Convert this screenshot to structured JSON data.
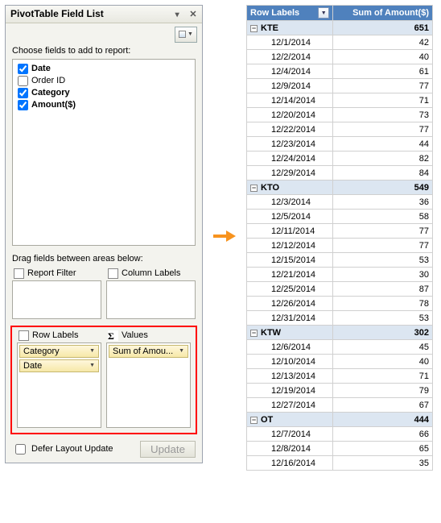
{
  "panel": {
    "title": "PivotTable Field List",
    "choose_label": "Choose fields to add to report:",
    "fields": [
      {
        "label": "Date",
        "checked": true
      },
      {
        "label": "Order ID",
        "checked": false
      },
      {
        "label": "Category",
        "checked": true
      },
      {
        "label": "Amount($)",
        "checked": true
      }
    ],
    "drag_label": "Drag fields between areas below:",
    "areas": {
      "report_filter": "Report Filter",
      "column_labels": "Column Labels",
      "row_labels": "Row Labels",
      "values": "Values"
    },
    "row_items": [
      "Category",
      "Date"
    ],
    "value_items": [
      "Sum of Amou..."
    ],
    "defer_label": "Defer Layout Update",
    "update_label": "Update"
  },
  "pivot": {
    "headers": {
      "rows": "Row Labels",
      "vals": "Sum of Amount($)"
    },
    "groups": [
      {
        "name": "KTE",
        "total": 651,
        "rows": [
          [
            "12/1/2014",
            42
          ],
          [
            "12/2/2014",
            40
          ],
          [
            "12/4/2014",
            61
          ],
          [
            "12/9/2014",
            77
          ],
          [
            "12/14/2014",
            71
          ],
          [
            "12/20/2014",
            73
          ],
          [
            "12/22/2014",
            77
          ],
          [
            "12/23/2014",
            44
          ],
          [
            "12/24/2014",
            82
          ],
          [
            "12/29/2014",
            84
          ]
        ]
      },
      {
        "name": "KTO",
        "total": 549,
        "rows": [
          [
            "12/3/2014",
            36
          ],
          [
            "12/5/2014",
            58
          ],
          [
            "12/11/2014",
            77
          ],
          [
            "12/12/2014",
            77
          ],
          [
            "12/15/2014",
            53
          ],
          [
            "12/21/2014",
            30
          ],
          [
            "12/25/2014",
            87
          ],
          [
            "12/26/2014",
            78
          ],
          [
            "12/31/2014",
            53
          ]
        ]
      },
      {
        "name": "KTW",
        "total": 302,
        "rows": [
          [
            "12/6/2014",
            45
          ],
          [
            "12/10/2014",
            40
          ],
          [
            "12/13/2014",
            71
          ],
          [
            "12/19/2014",
            79
          ],
          [
            "12/27/2014",
            67
          ]
        ]
      },
      {
        "name": "OT",
        "total": 444,
        "rows": [
          [
            "12/7/2014",
            66
          ],
          [
            "12/8/2014",
            65
          ],
          [
            "12/16/2014",
            35
          ]
        ]
      }
    ]
  }
}
